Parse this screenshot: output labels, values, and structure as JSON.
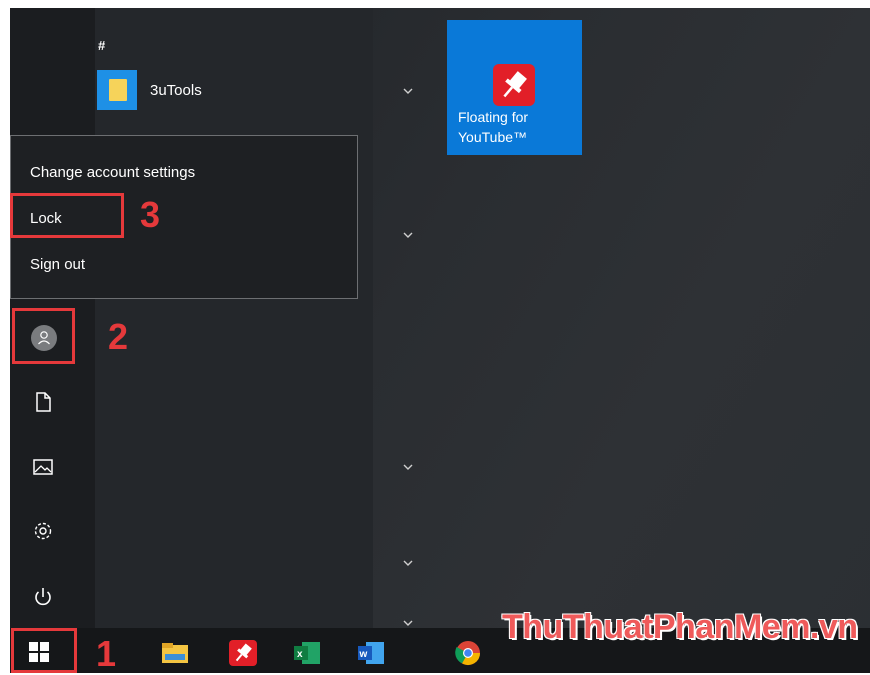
{
  "applist": {
    "section_letter": "#",
    "apps": [
      {
        "label": "3uTools",
        "icon": "folder-icon"
      }
    ]
  },
  "tile": {
    "label_line1": "Floating for",
    "label_line2": "YouTube™",
    "icon": "pushpin-icon",
    "color": "#0a79d8"
  },
  "account_menu": {
    "items": [
      {
        "label": "Change account settings"
      },
      {
        "label": "Lock"
      },
      {
        "label": "Sign out"
      }
    ]
  },
  "rail": {
    "icons": [
      "user-avatar-icon",
      "document-icon",
      "pictures-icon",
      "settings-gear-icon",
      "power-icon"
    ]
  },
  "taskbar": {
    "icons": [
      "windows-start-icon",
      "file-explorer-icon",
      "floating-youtube-icon",
      "excel-icon",
      "word-icon",
      "chrome-icon"
    ]
  },
  "annotations": {
    "step1": "1",
    "step2": "2",
    "step3": "3",
    "highlight_color": "#e5393b"
  },
  "watermark": {
    "text": "ThuThuatPhanMem.vn"
  }
}
